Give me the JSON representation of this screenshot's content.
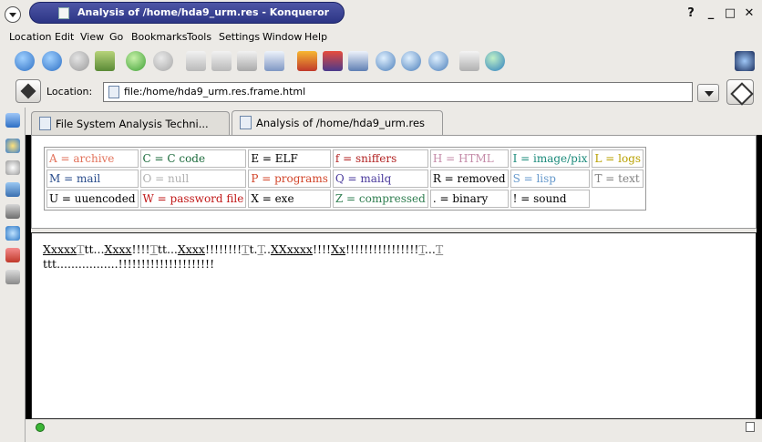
{
  "window": {
    "title": "Analysis of /home/hda9_urm.res - Konqueror",
    "controls": [
      "?",
      "_",
      "□",
      "✕"
    ]
  },
  "menubar": [
    "Location",
    "Edit",
    "View",
    "Go",
    "Bookmarks",
    "Tools",
    "Settings",
    "Window",
    "Help"
  ],
  "toolbar": {
    "icons": [
      "up-arrow-icon",
      "back-arrow-icon",
      "forward-arrow-icon",
      "home-icon",
      "reload-icon",
      "stop-icon",
      "cut-icon",
      "copy-icon",
      "paste-icon",
      "print-icon",
      "bookmark-icon",
      "security-icon",
      "new-window-icon",
      "find-icon",
      "zoom-in-icon",
      "zoom-out-icon",
      "security-key-icon",
      "globe-icon"
    ]
  },
  "location": {
    "label": "Location:",
    "value": "file:/home/hda9_urm.res.frame.html"
  },
  "tabs": [
    {
      "label": "File System Analysis Techni..."
    },
    {
      "label": "Analysis of /home/hda9_urm.res"
    }
  ],
  "legend": [
    [
      {
        "text": "A = archive",
        "color": "#e2725b"
      },
      {
        "text": "C = C code",
        "color": "#1c6b3c"
      },
      {
        "text": "E = ELF",
        "color": "#000000"
      },
      {
        "text": "f = sniffers",
        "color": "#b22222"
      },
      {
        "text": "H = HTML",
        "color": "#c48ba8"
      },
      {
        "text": "I = image/pix",
        "color": "#1a8a7a"
      },
      {
        "text": "L = logs",
        "color": "#b8a000"
      }
    ],
    [
      {
        "text": "M = mail",
        "color": "#2a4d8c"
      },
      {
        "text": "O = null",
        "color": "#b0b0b0"
      },
      {
        "text": "P = programs",
        "color": "#d2452a"
      },
      {
        "text": "Q = mailq",
        "color": "#4a3a9c"
      },
      {
        "text": "R = removed",
        "color": "#000000"
      },
      {
        "text": "S = lisp",
        "color": "#6699cc"
      },
      {
        "text": "T = text",
        "color": "#808080"
      }
    ],
    [
      {
        "text": "U = uuencoded",
        "color": "#000000"
      },
      {
        "text": "W = password file",
        "color": "#c01818"
      },
      {
        "text": "X = exe",
        "color": "#000000"
      },
      {
        "text": "Z = compressed",
        "color": "#2e7d4f"
      },
      {
        "text": ". = binary",
        "color": "#000000"
      },
      {
        "text": "! = sound",
        "color": "#000000"
      }
    ]
  ],
  "content": {
    "line1": [
      {
        "t": "X",
        "u": true
      },
      {
        "t": "xxxx",
        "u": true
      },
      {
        "t": "T",
        "gray": true
      },
      {
        "t": "tt..."
      },
      {
        "t": "X",
        "u": true
      },
      {
        "t": "xxx",
        "u": true
      },
      {
        "t": "!!!!"
      },
      {
        "t": "T",
        "gray": true
      },
      {
        "t": "tt..."
      },
      {
        "t": "X",
        "u": true
      },
      {
        "t": "xxx",
        "u": true
      },
      {
        "t": "!!!!!!!!"
      },
      {
        "t": "T",
        "gray": true
      },
      {
        "t": "t."
      },
      {
        "t": "T",
        "gray": true
      },
      {
        "t": ".."
      },
      {
        "t": "XX",
        "u": true
      },
      {
        "t": "xxxx",
        "u": true
      },
      {
        "t": "!!!!"
      },
      {
        "t": "X",
        "u": true
      },
      {
        "t": "x",
        "u": true
      },
      {
        "t": "!!!!!!!!!!!!!!!!"
      },
      {
        "t": "T",
        "gray": true
      },
      {
        "t": "..."
      },
      {
        "t": "T",
        "gray": true
      }
    ],
    "line2": "ttt.................!!!!!!!!!!!!!!!!!!!!!"
  }
}
